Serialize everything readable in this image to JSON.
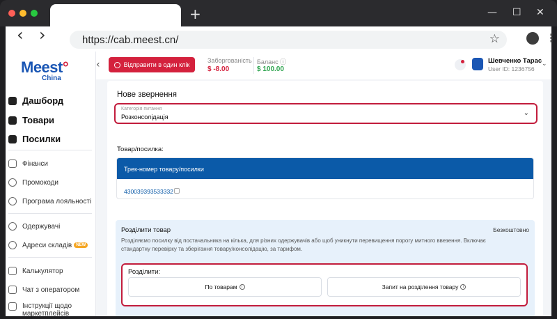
{
  "browser": {
    "url": "https://cab.meest.cn/",
    "new_tab": "+",
    "minimize": "—",
    "maximize": "☐",
    "close": "✕",
    "back": "‹",
    "forward": "›",
    "bookmark": "☆",
    "menu": "⋮"
  },
  "brand": {
    "name_blue": "Meest",
    "name_red": "°",
    "sub": "China"
  },
  "sidebar": {
    "main_items": [
      {
        "label": "Дашборд",
        "icon": "dashboard-icon"
      },
      {
        "label": "Товари",
        "icon": "box-icon"
      },
      {
        "label": "Посилки",
        "icon": "package-icon"
      }
    ],
    "group1": [
      {
        "label": "Фінанси",
        "icon": "wallet-icon"
      },
      {
        "label": "Промокоди",
        "icon": "percent-icon"
      },
      {
        "label": "Програма лояльності",
        "icon": "loyalty-icon"
      }
    ],
    "group2": [
      {
        "label": "Одержувачі",
        "icon": "users-icon"
      },
      {
        "label": "Адреси складів",
        "icon": "location-icon",
        "badge": "NEW"
      }
    ],
    "group3": [
      {
        "label": "Калькулятор",
        "icon": "calculator-icon"
      },
      {
        "label": "Чат з оператором",
        "icon": "chat-icon"
      },
      {
        "label": "Інструкції щодо маркетплейсів",
        "icon": "doc-icon"
      }
    ]
  },
  "header": {
    "collapse": "‹",
    "send_button": "Відправити в один клік",
    "debt_label": "Заборгованість",
    "debt_value": "$ -8.00",
    "balance_label": "Баланс ⓘ",
    "balance_value": "$ 100.00",
    "user_name": "Шевченко Тарас",
    "user_id": "User ID: 1236756",
    "user_chevron": "⌄",
    "colors": {
      "accent": "#d4213d",
      "positive": "#2ea44f",
      "brand": "#1a56b4"
    }
  },
  "form": {
    "title": "Нове звернення",
    "category_label": "Категорія питання",
    "category_value": "Розконсолідація",
    "category_chevron": "⌄",
    "section_title": "Товар/посилка:",
    "table_header": "Трек-номер товару/посилки",
    "track_number": "430039393533332",
    "split_title": "Розділити товар",
    "split_price": "Безкоштовно",
    "split_desc": "Розділяємо посилку від постачальника на кілька, для різних одержувачів або щоб уникнути перевищення порогу митного ввезення. Включає стандартну перевірку та зберігання товару/консолідацію, за тарифом.",
    "split_label": "Розділити:",
    "option1": "По товарам",
    "option2": "Запит на розділення товару",
    "info_glyph": "i"
  }
}
